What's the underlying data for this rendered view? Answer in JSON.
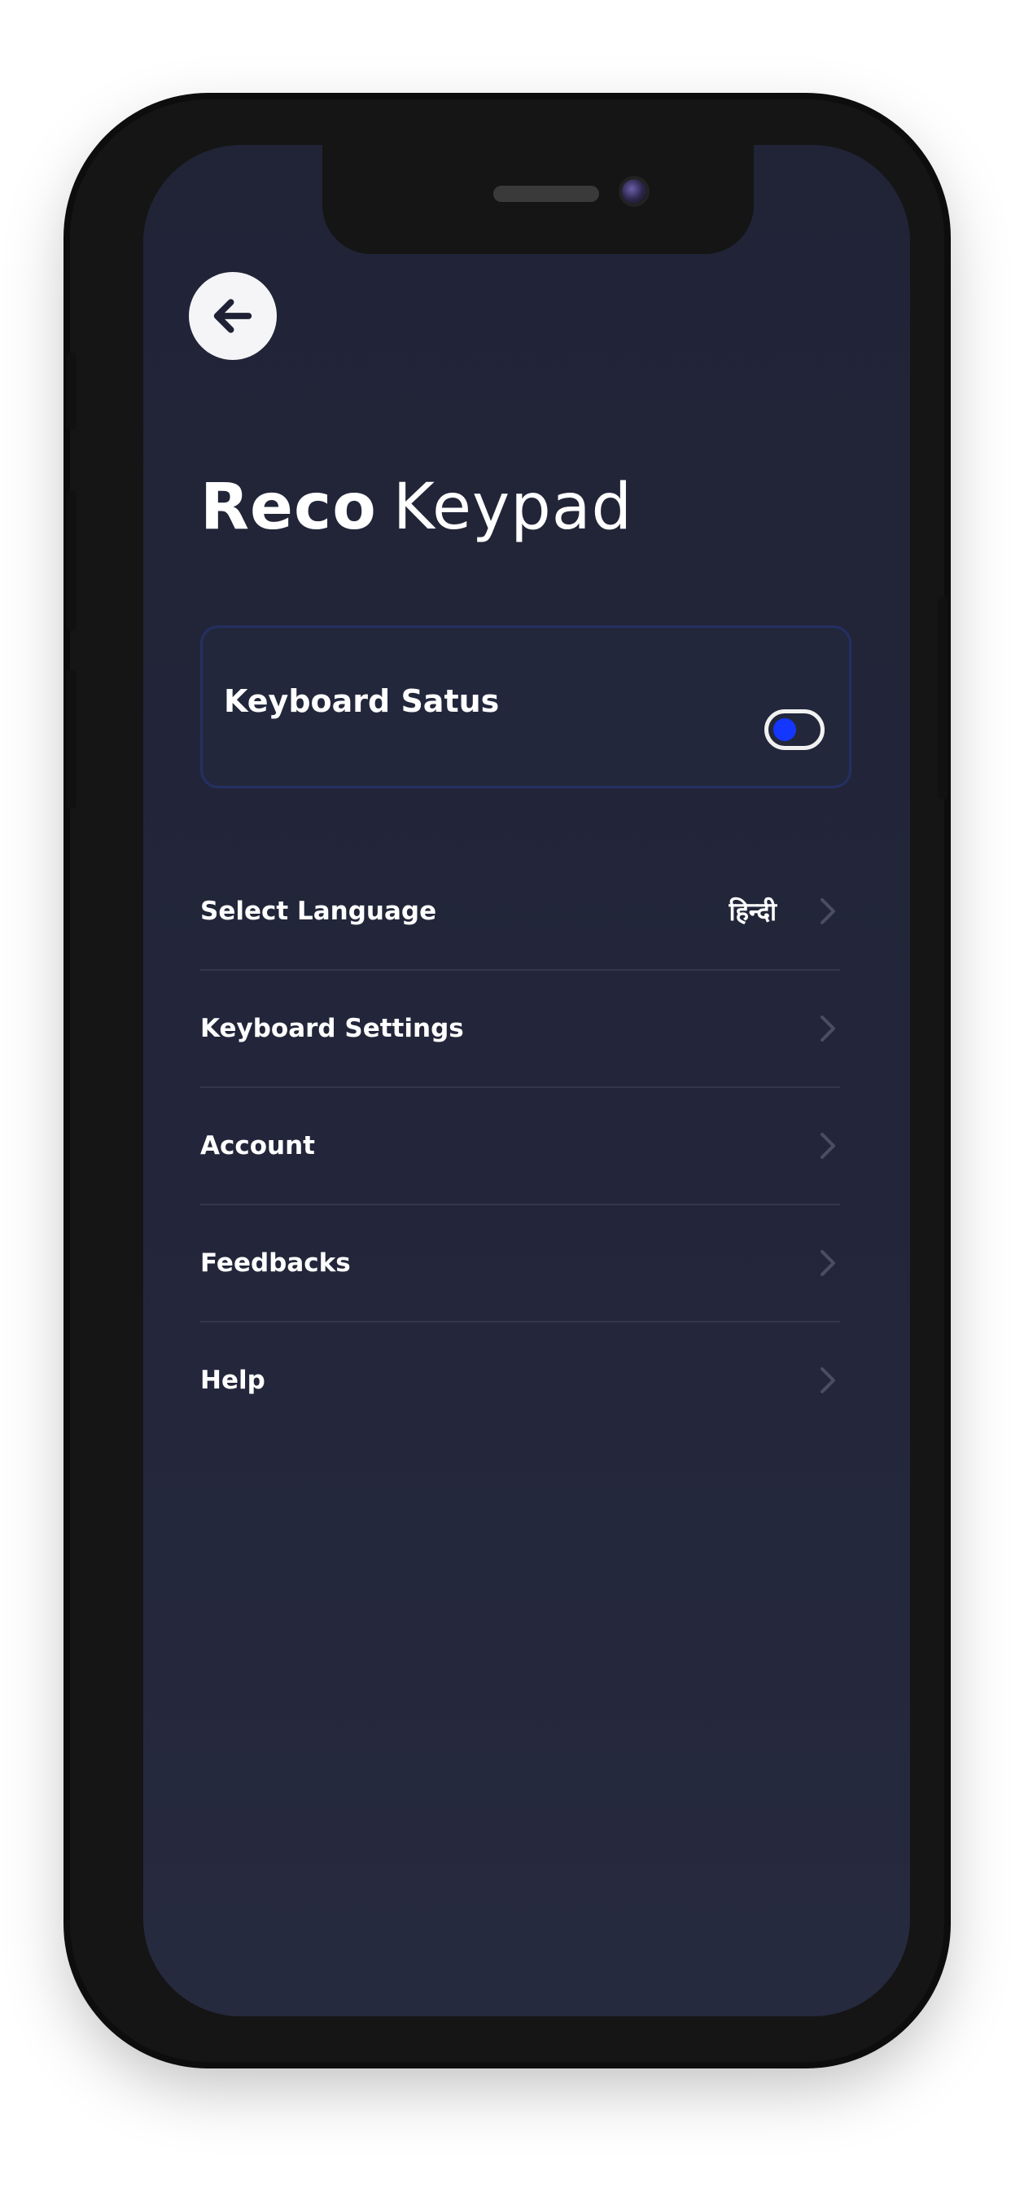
{
  "header": {
    "back_icon": "arrow-left-icon",
    "title_bold": "Reco",
    "title_light": "Keypad"
  },
  "keyboard_status": {
    "label": "Keyboard Satus",
    "enabled": true
  },
  "menu": {
    "items": [
      {
        "label": "Select Language",
        "value": "हिन्दी"
      },
      {
        "label": "Keyboard Settings"
      },
      {
        "label": "Account"
      },
      {
        "label": "Feedbacks"
      },
      {
        "label": "Help"
      }
    ]
  },
  "colors": {
    "background": "#222538",
    "accent": "#1437ff",
    "card_border": "#243063",
    "divider": "#33374a",
    "text": "#ffffff",
    "chevron": "#4a4e62"
  }
}
